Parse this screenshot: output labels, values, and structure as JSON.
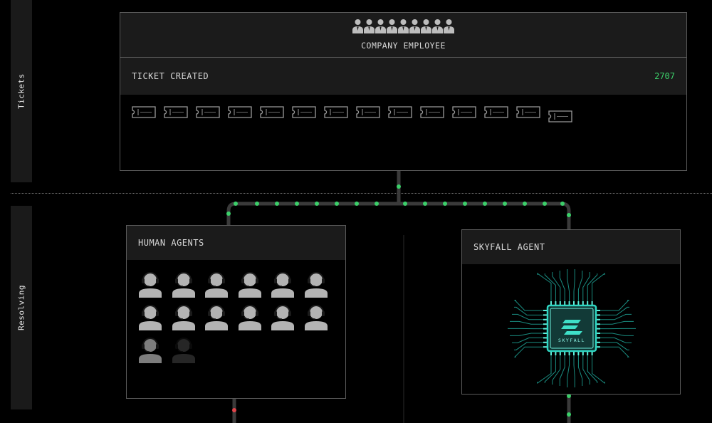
{
  "sidebar": {
    "tickets_label": "Tickets",
    "resolving_label": "Resolving"
  },
  "employee_panel": {
    "label": "COMPANY EMPLOYEE",
    "employee_icon_count": 9
  },
  "ticket_panel": {
    "label": "TICKET CREATED",
    "count": "2707",
    "ticket_icon_count": 14
  },
  "human_agents": {
    "label": "HUMAN AGENTS",
    "active_agents": 13,
    "faded_agents": 1
  },
  "skyfall_agent": {
    "label": "SKYFALL AGENT",
    "chip_label": "SKYFALL"
  },
  "colors": {
    "accent_green": "#3ccf6a",
    "alert_red": "#e0444a",
    "chip_teal": "#2fd6c2",
    "panel_header": "#1b1b1b"
  }
}
